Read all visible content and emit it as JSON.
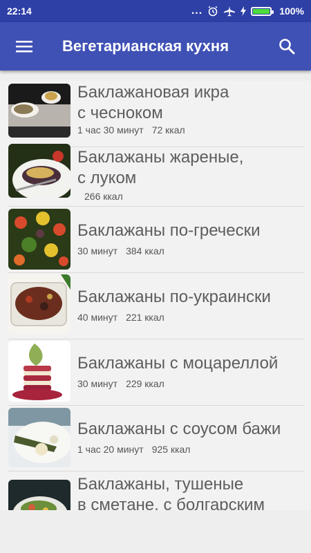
{
  "status": {
    "time": "22:14",
    "dots": "...",
    "battery": "100%"
  },
  "appbar": {
    "title": "Вегетарианская кухня"
  },
  "recipes": [
    {
      "name_line1": "Баклажановая икра",
      "name_line2": "с чесноком",
      "time": "1 час 30 минут",
      "kcal": "72 ккал"
    },
    {
      "name_line1": "Баклажаны жареные,",
      "name_line2": "с луком",
      "time": "",
      "kcal": "266 ккал"
    },
    {
      "name_line1": "Баклажаны по-гречески",
      "name_line2": "",
      "time": "30 минут",
      "kcal": "384 ккал"
    },
    {
      "name_line1": "Баклажаны по-украински",
      "name_line2": "",
      "time": "40 минут",
      "kcal": "221 ккал"
    },
    {
      "name_line1": "Баклажаны с моцареллой",
      "name_line2": "",
      "time": "30 минут",
      "kcal": "229 ккал"
    },
    {
      "name_line1": "Баклажаны с соусом бажи",
      "name_line2": "",
      "time": "1 час 20 минут",
      "kcal": "925 ккал"
    },
    {
      "name_line1": "Баклажаны, тушеные",
      "name_line2": "в сметане, с болгарским",
      "time": "",
      "kcal": ""
    }
  ]
}
